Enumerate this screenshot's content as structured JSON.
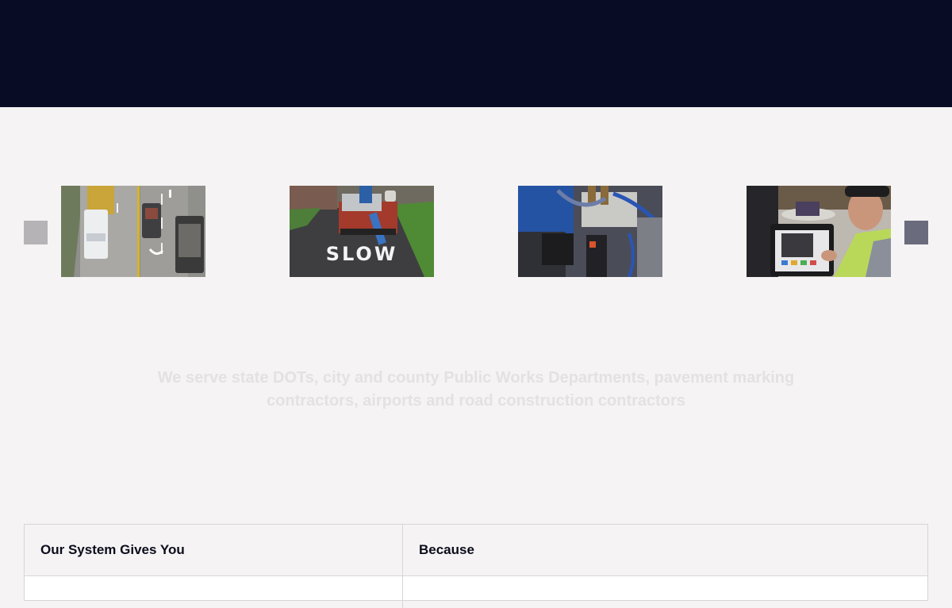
{
  "colors": {
    "header_band": "#080c25",
    "page_background": "#f5f3f3",
    "arrow_prev": "#b6b3b6",
    "arrow_next": "#6a6b7c",
    "table_border": "#d7d5d7"
  },
  "carousel": {
    "prev_icon": "square-prev-arrow-icon",
    "next_icon": "square-next-arrow-icon",
    "slides": [
      {
        "subject": "truck-traffic-photo"
      },
      {
        "subject": "road-marking-truck-photo",
        "road_text": "SLOW"
      },
      {
        "subject": "machinery-hoses-photo"
      },
      {
        "subject": "worker-tablet-photo"
      }
    ]
  },
  "tagline": {
    "text": "We serve state DOTs, city and county Public Works Departments, pavement marking contractors, airports and road construction contractors"
  },
  "table": {
    "headers": [
      "Our System Gives You",
      "Because"
    ]
  }
}
